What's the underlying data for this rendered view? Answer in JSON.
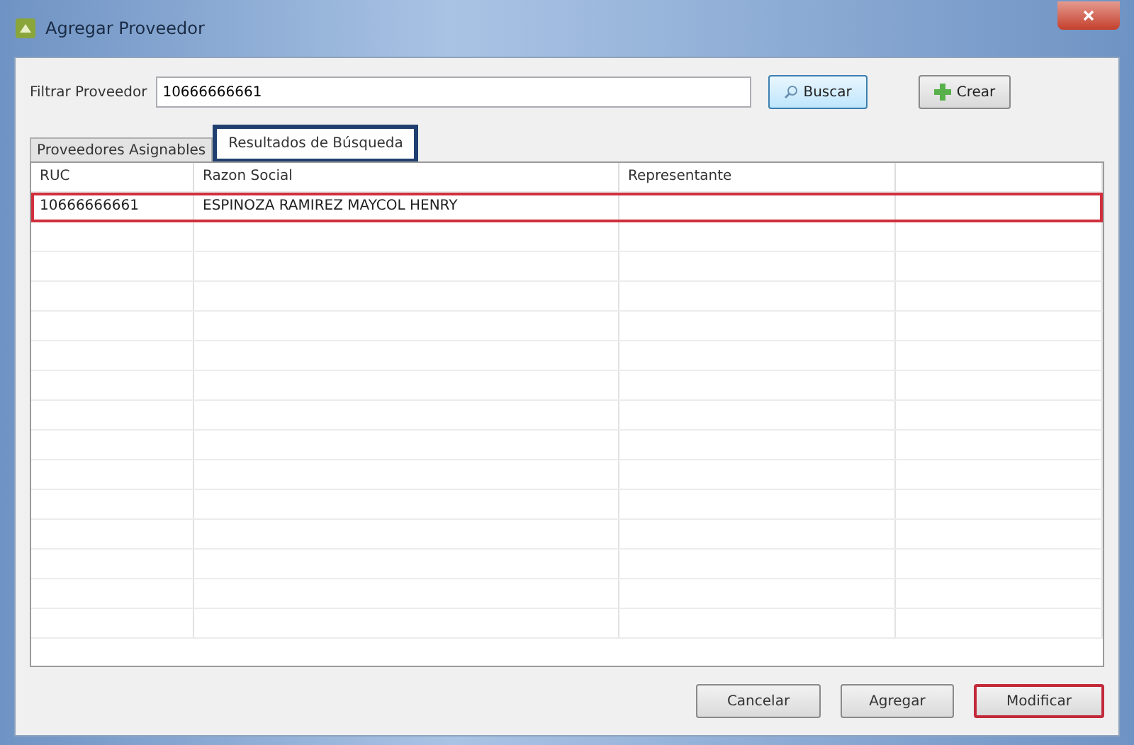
{
  "window": {
    "title": "Agregar Proveedor"
  },
  "filter": {
    "label": "Filtrar Proveedor",
    "value": "10666666661"
  },
  "toolbar_buttons": [
    {
      "label": "Buscar",
      "kind": "search",
      "focused": true
    },
    {
      "label": "Crear",
      "kind": "create",
      "focused": false
    }
  ],
  "tabs": [
    {
      "label": "Proveedores Asignables",
      "selected": false
    },
    {
      "label": "Resultados de Búsqueda",
      "selected": true
    }
  ],
  "table": {
    "columns": [
      "RUC",
      "Razon Social",
      "Representante"
    ],
    "rows": [
      {
        "cells": [
          "10666666661",
          "ESPINOZA RAMIREZ MAYCOL HENRY",
          ""
        ],
        "selected": true
      }
    ]
  },
  "buttons": [
    {
      "label": "Cancelar",
      "highlighted": false
    },
    {
      "label": "Agregar",
      "highlighted": false
    },
    {
      "label": "Modificar",
      "highlighted": true
    }
  ]
}
